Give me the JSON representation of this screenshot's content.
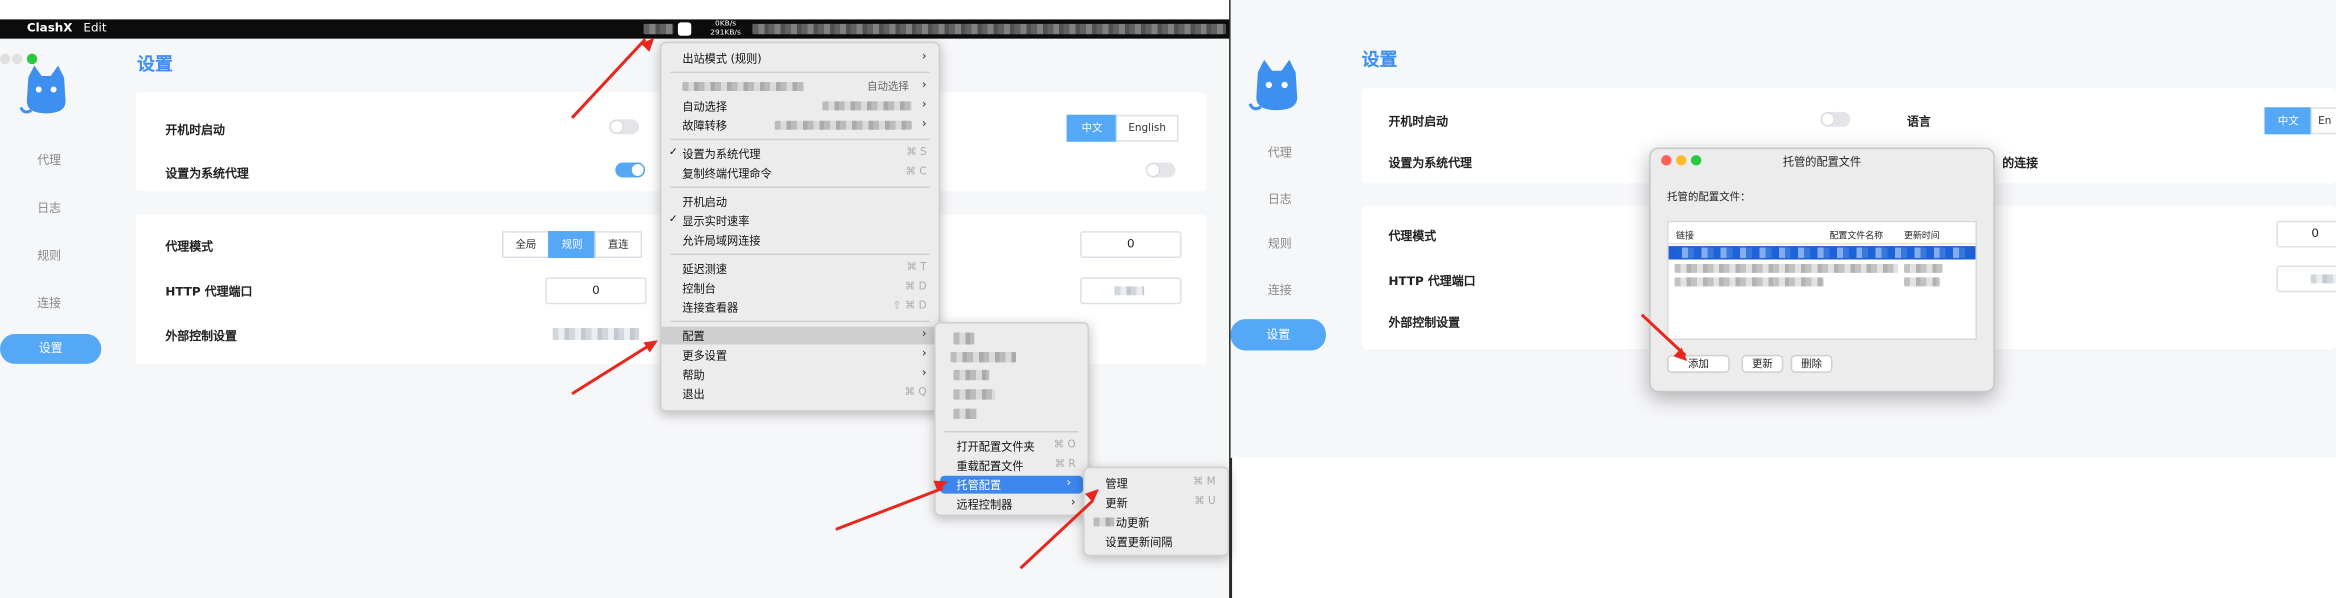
{
  "menubar": {
    "app": "ClashX",
    "edit": "Edit",
    "speed_up": "0KB/s",
    "speed_down": "291KB/s"
  },
  "app": {
    "title": "设置",
    "sidebar": [
      "代理",
      "日志",
      "规则",
      "连接",
      "设置"
    ],
    "settings": {
      "launch_at_login": "开机时启动",
      "system_proxy": "设置为系统代理",
      "proxy_mode": "代理模式",
      "http_port": "HTTP 代理端口",
      "external_control": "外部控制设置",
      "language": "语言",
      "connections": "的连接",
      "mode_global": "全局",
      "mode_rule": "规则",
      "mode_direct": "直连",
      "lang_zh": "中文",
      "lang_en": "English",
      "lang_en_short": "En",
      "port_value": "0",
      "socks_value": "0"
    }
  },
  "main_menu": {
    "outbound_mode": "出站模式 (规则)",
    "auto_select_right": "自动选择",
    "auto_select": "自动选择",
    "failover": "故障转移",
    "set_system_proxy": "设置为系统代理",
    "set_system_proxy_sc": "⌘ S",
    "copy_shell_cmd": "复制终端代理命令",
    "copy_shell_cmd_sc": "⌘ C",
    "launch_at_login": "开机启动",
    "show_speed": "显示实时速率",
    "allow_lan": "允许局域网连接",
    "latency_test": "延迟测速",
    "latency_test_sc": "⌘ T",
    "dashboard": "控制台",
    "dashboard_sc": "⌘ D",
    "conn_viewer": "连接查看器",
    "conn_viewer_sc": "⇧ ⌘ D",
    "config": "配置",
    "more_settings": "更多设置",
    "help": "帮助",
    "quit": "退出",
    "quit_sc": "⌘ Q"
  },
  "config_menu": {
    "open_folder": "打开配置文件夹",
    "open_folder_sc": "⌘ O",
    "reload": "重载配置文件",
    "reload_sc": "⌘ R",
    "managed": "托管配置",
    "remote_controller": "远程控制器"
  },
  "managed_menu": {
    "manage": "管理",
    "manage_sc": "⌘ M",
    "update": "更新",
    "update_sc": "⌘ U",
    "auto_update": "动更新",
    "update_interval": "设置更新间隔"
  },
  "dialog": {
    "title": "托管的配置文件",
    "subtitle": "托管的配置文件：",
    "col_link": "链接",
    "col_name": "配置文件名称",
    "col_time": "更新时间",
    "add": "添加",
    "update": "更新",
    "delete": "删除"
  },
  "colors": {
    "accent": "#55a8f5",
    "menu_highlight": "#3d86ee",
    "arrow": "#e8261c"
  }
}
